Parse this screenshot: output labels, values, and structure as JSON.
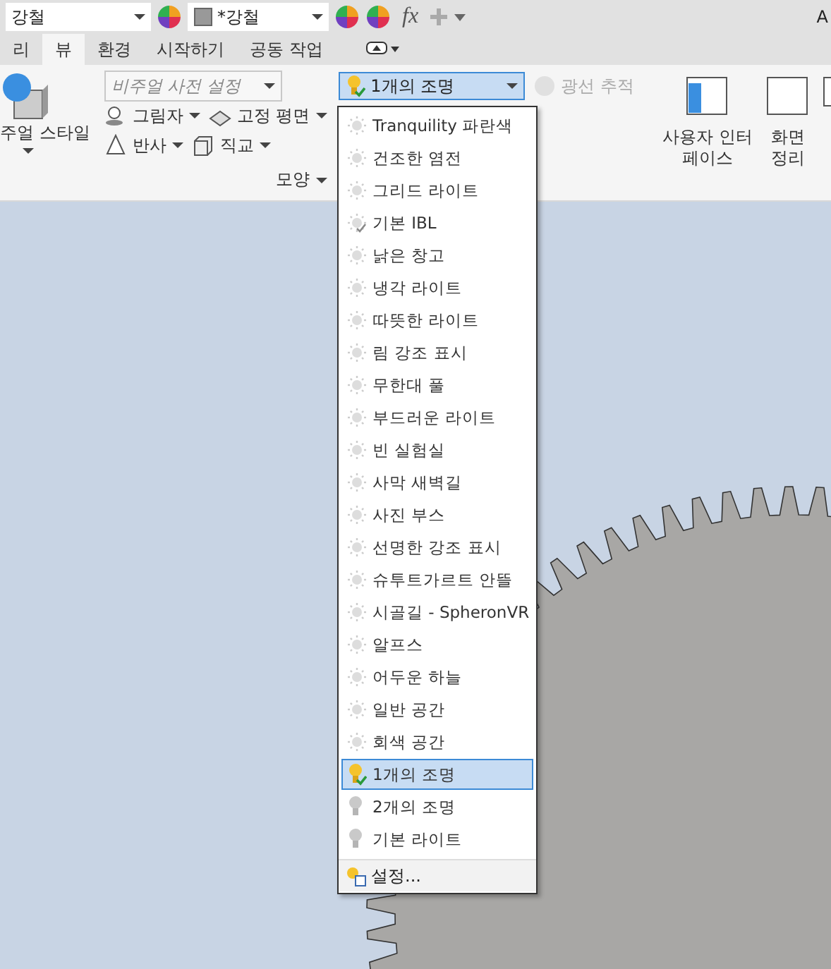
{
  "toolbar": {
    "material": "강철",
    "appearance": "*강철",
    "fx": "fx",
    "cut_label": "A"
  },
  "tabs": [
    {
      "label": "리",
      "selected": false
    },
    {
      "label": "뷰",
      "selected": true
    },
    {
      "label": "환경",
      "selected": false
    },
    {
      "label": "시작하기",
      "selected": false
    },
    {
      "label": "공동 작업",
      "selected": false
    }
  ],
  "ribbon": {
    "visual_style": "주얼 스타일",
    "preset": {
      "placeholder": "비주얼 사전 설정"
    },
    "shadow": "그림자",
    "ground_plane": "고정 평면",
    "reflection": "반사",
    "orthographic": "직교",
    "panel_title": "모양",
    "lighting": "1개의 조명",
    "ray_tracing": {
      "label": "광선 추적",
      "disabled": true
    },
    "user_interface": "사용자 인터페이스",
    "cleanup": "화면 정리"
  },
  "lighting_menu": {
    "items": [
      {
        "label": "Tranquility 파란색",
        "kind": "sun",
        "selected": false
      },
      {
        "label": "건조한 염전",
        "kind": "sun",
        "selected": false
      },
      {
        "label": "그리드 라이트",
        "kind": "sun",
        "selected": false
      },
      {
        "label": "기본 IBL",
        "kind": "sun-check",
        "selected": false
      },
      {
        "label": "낡은 창고",
        "kind": "sun",
        "selected": false
      },
      {
        "label": "냉각 라이트",
        "kind": "sun",
        "selected": false
      },
      {
        "label": "따뜻한 라이트",
        "kind": "sun",
        "selected": false
      },
      {
        "label": "림 강조 표시",
        "kind": "sun",
        "selected": false
      },
      {
        "label": "무한대 풀",
        "kind": "sun",
        "selected": false
      },
      {
        "label": "부드러운 라이트",
        "kind": "sun",
        "selected": false
      },
      {
        "label": "빈 실험실",
        "kind": "sun",
        "selected": false
      },
      {
        "label": "사막 새벽길",
        "kind": "sun",
        "selected": false
      },
      {
        "label": "사진 부스",
        "kind": "sun",
        "selected": false
      },
      {
        "label": "선명한 강조 표시",
        "kind": "sun",
        "selected": false
      },
      {
        "label": "슈투트가르트 안뜰",
        "kind": "sun",
        "selected": false
      },
      {
        "label": "시골길 - SpheronVR",
        "kind": "sun",
        "selected": false
      },
      {
        "label": "알프스",
        "kind": "sun",
        "selected": false
      },
      {
        "label": "어두운 하늘",
        "kind": "sun",
        "selected": false
      },
      {
        "label": "일반 공간",
        "kind": "sun",
        "selected": false
      },
      {
        "label": "회색 공간",
        "kind": "sun",
        "selected": false
      },
      {
        "label": "1개의 조명",
        "kind": "bulb",
        "selected": true
      },
      {
        "label": "2개의 조명",
        "kind": "bulb",
        "selected": false
      },
      {
        "label": "기본 라이트",
        "kind": "bulb",
        "selected": false
      }
    ],
    "settings": "설정..."
  }
}
